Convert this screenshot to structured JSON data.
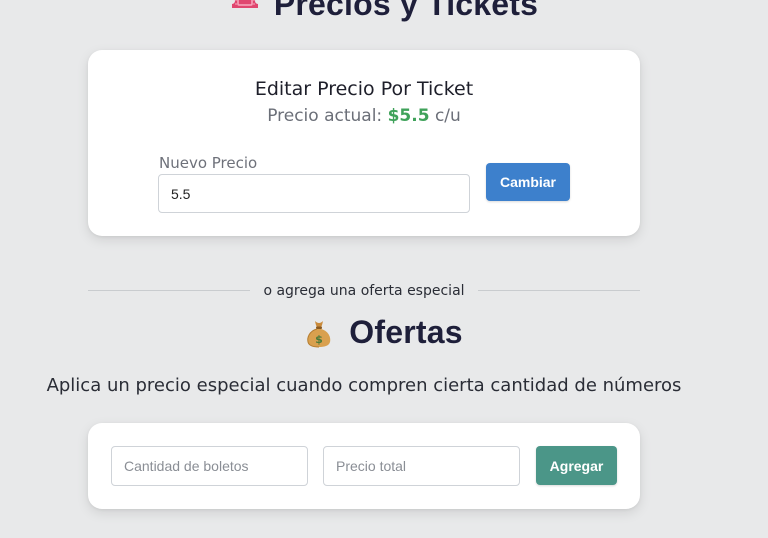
{
  "header": {
    "title": "Precios y Tickets",
    "icon": "ticket-icon"
  },
  "price_card": {
    "title": "Editar Precio Por Ticket",
    "current_prefix": "Precio actual:",
    "current_price": "$5.5",
    "current_unit": "c/u",
    "field_label": "Nuevo Precio",
    "field_value": "5.5",
    "button_label": "Cambiar"
  },
  "divider": {
    "text": "o agrega una oferta especial"
  },
  "offers": {
    "title": "Ofertas",
    "icon": "money-bag-icon",
    "description": "Aplica un precio especial cuando compren cierta cantidad de números",
    "quantity_placeholder": "Cantidad de boletos",
    "total_placeholder": "Precio total",
    "button_label": "Agregar"
  },
  "colors": {
    "background": "#e8e9ea",
    "price_green": "#3fa25a",
    "cambiar_blue": "#3d80cc",
    "agregar_teal": "#4b9688",
    "title_dark": "#1e1f3a"
  }
}
